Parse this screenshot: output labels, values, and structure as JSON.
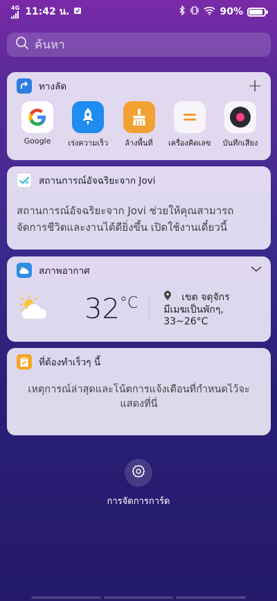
{
  "status_bar": {
    "network": "4G",
    "time": "11:42 น.",
    "battery": "90%",
    "battery_level": 0.9
  },
  "search": {
    "placeholder": "ค้นหา"
  },
  "shortcuts": {
    "title": "ทางลัด",
    "add_label": "+",
    "apps": [
      {
        "label": "Google",
        "icon": "google-icon"
      },
      {
        "label": "เร่งความเร็ว",
        "icon": "rocket-icon"
      },
      {
        "label": "ล้างพื้นที่",
        "icon": "broom-icon"
      },
      {
        "label": "เครื่องคิดเลข",
        "icon": "calculator-icon"
      },
      {
        "label": "บันทึกเสียง",
        "icon": "recorder-icon"
      }
    ]
  },
  "jovi": {
    "title": "สถานการณ์อัจฉริยะจาก Jovi",
    "description": "สถานการณ์อัจฉริยะจาก Jovi ช่วยให้คุณสามารถจัดการชีวิตและงานได้ดียิ่งขึ้น เปิดใช้งานเดี๋ยวนี้"
  },
  "weather": {
    "title": "สภาพอากาศ",
    "temperature": "32",
    "unit": "°C",
    "location": "เขต จตุจักร",
    "condition": "มีเมฆเป็นพักๆ,",
    "range": "33~26°C"
  },
  "todo": {
    "title": "ที่ต้องทำเร็วๆ นี้",
    "message": "เหตุการณ์ล่าสุดและโน้ตการแจ้งเตือนที่กำหนดไว้จะแสดงที่นี่"
  },
  "manage": {
    "label": "การจัดการการ์ด"
  },
  "colors": {
    "accent_blue": "#2f7de1",
    "orange": "#f4a134",
    "card_bg": "#ece6f6"
  }
}
